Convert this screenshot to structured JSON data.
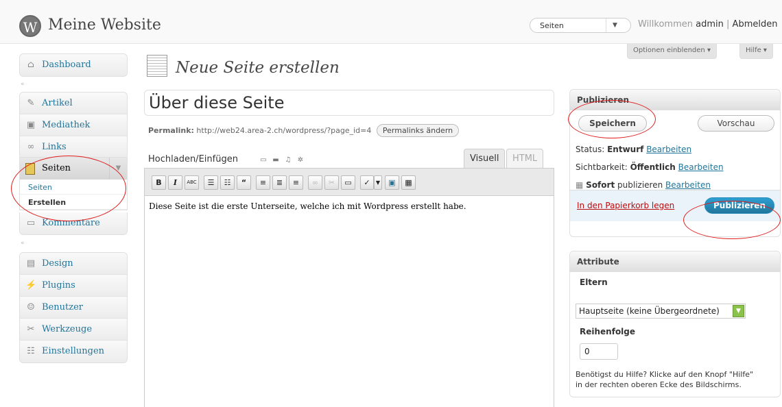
{
  "header": {
    "site_title": "Meine Website",
    "favorites_selected": "Seiten",
    "welcome": "Willkommen",
    "username": "admin",
    "separator": "|",
    "logout": "Abmelden"
  },
  "screen_meta": {
    "options": "Optionen einblenden",
    "help": "Hilfe"
  },
  "sidebar": {
    "dashboard": "Dashboard",
    "items_top": [
      "Artikel",
      "Mediathek",
      "Links"
    ],
    "pages_label": "Seiten",
    "pages_sub": [
      "Seiten",
      "Erstellen"
    ],
    "comments": "Kommentare",
    "items_bottom": [
      "Design",
      "Plugins",
      "Benutzer",
      "Werkzeuge",
      "Einstellungen"
    ]
  },
  "main": {
    "heading": "Neue Seite erstellen",
    "title_value": "Über diese Seite",
    "permalink_label": "Permalink:",
    "permalink_url": "http://web24.area-2.ch/wordpress/?page_id=4",
    "permalink_button": "Permalinks ändern",
    "upload_label": "Hochladen/Einfügen",
    "tab_visual": "Visuell",
    "tab_html": "HTML",
    "content": "Diese Seite ist die erste Unterseite, welche ich mit Wordpress erstellt habe."
  },
  "publish": {
    "title": "Publizieren",
    "save": "Speichern",
    "preview": "Vorschau",
    "status_label": "Status:",
    "status_value": "Entwurf",
    "visibility_label": "Sichtbarkeit:",
    "visibility_value": "Öffentlich",
    "schedule_value": "Sofort",
    "schedule_label": "publizieren",
    "edit": "Bearbeiten",
    "trash": "In den Papierkorb legen",
    "publish_button": "Publizieren"
  },
  "attributes": {
    "title": "Attribute",
    "parent_label": "Eltern",
    "parent_value": "Hauptseite (keine Übergeordnete)",
    "order_label": "Reihenfolge",
    "order_value": "0",
    "help_text": "Benötigst du Hilfe? Klicke auf den Knopf \"Hilfe\" in der rechten oberen Ecke des Bildschirms."
  },
  "colors": {
    "link": "#21759b",
    "annotation": "#e01b1b",
    "publish": "#21759b"
  }
}
